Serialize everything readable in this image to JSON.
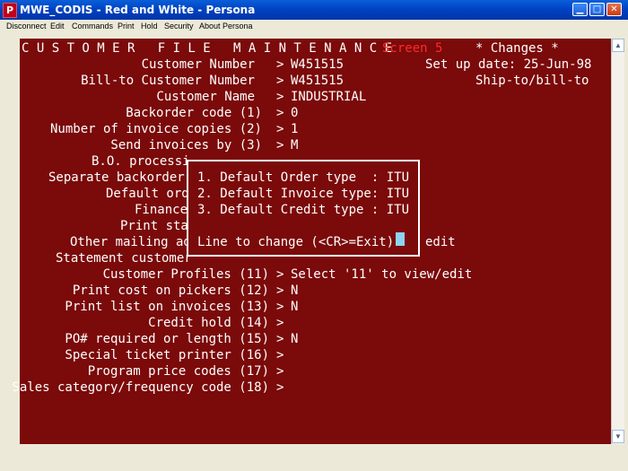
{
  "window": {
    "title": "MWE_CODIS - Red and White - Persona",
    "icon_letter": "P",
    "controls": [
      "minimize",
      "maximize",
      "close"
    ]
  },
  "menu": [
    "Disconnect",
    "Edit",
    "Commands",
    "Print",
    "Hold",
    "Security",
    "About Persona"
  ],
  "screen": {
    "heading": "C U S T O M E R   F I L E   M A I N T E N A N C E",
    "screen_label": "Screen 5",
    "changes_label": "* Changes *",
    "setup_date": "Set up date: 25-Jun-98",
    "ship_bill": "Ship-to/bill-to",
    "fields": [
      {
        "label": "Customer Number",
        "sep": ">",
        "value": "W451515"
      },
      {
        "label": "Bill-to Customer Number",
        "sep": ">",
        "value": "W451515"
      },
      {
        "label": "Customer Name",
        "sep": ">",
        "value": "INDUSTRIAL"
      },
      {
        "label": "Backorder code (1)",
        "sep": ">",
        "value": "0"
      },
      {
        "label": "Number of invoice copies (2)",
        "sep": ">",
        "value": "1"
      },
      {
        "label": "Send invoices by (3)",
        "sep": ">",
        "value": "M"
      },
      {
        "label": "B.O. processi",
        "sep": "",
        "value": ""
      },
      {
        "label": "Separate backorder",
        "sep": "",
        "value": ""
      },
      {
        "label": "Default ord",
        "sep": "",
        "value": ""
      },
      {
        "label": "Finance",
        "sep": "",
        "value": ""
      },
      {
        "label": "Print sta",
        "sep": "",
        "value": ""
      },
      {
        "label": "Other mailing ad",
        "sep": "",
        "value": "edit"
      },
      {
        "label": "Statement customer",
        "sep": "",
        "value": ""
      },
      {
        "label": "Customer Profiles (11)",
        "sep": ">",
        "value": "Select '11' to view/edit"
      },
      {
        "label": "Print cost on pickers (12)",
        "sep": ">",
        "value": "N"
      },
      {
        "label": "Print list on invoices (13)",
        "sep": ">",
        "value": "N"
      },
      {
        "label": "Credit hold (14)",
        "sep": ">",
        "value": ""
      },
      {
        "label": "PO# required or length (15)",
        "sep": ">",
        "value": "N"
      },
      {
        "label": "Special ticket printer (16)",
        "sep": ">",
        "value": ""
      },
      {
        "label": "Program price codes (17)",
        "sep": ">",
        "value": ""
      },
      {
        "label": "Sales category/frequency code (18)",
        "sep": ">",
        "value": ""
      }
    ]
  },
  "popup": {
    "lines": [
      "1. Default Order type  : ITU",
      "2. Default Invoice type: ITU",
      "3. Default Credit type : ITU"
    ],
    "prompt": "Line to change (<CR>=Exit):"
  },
  "colors": {
    "terminal_bg": "#7b0a0a",
    "terminal_text": "#ffffff",
    "screen_label": "#ff2a2a",
    "cursor": "#8ed4f0"
  }
}
